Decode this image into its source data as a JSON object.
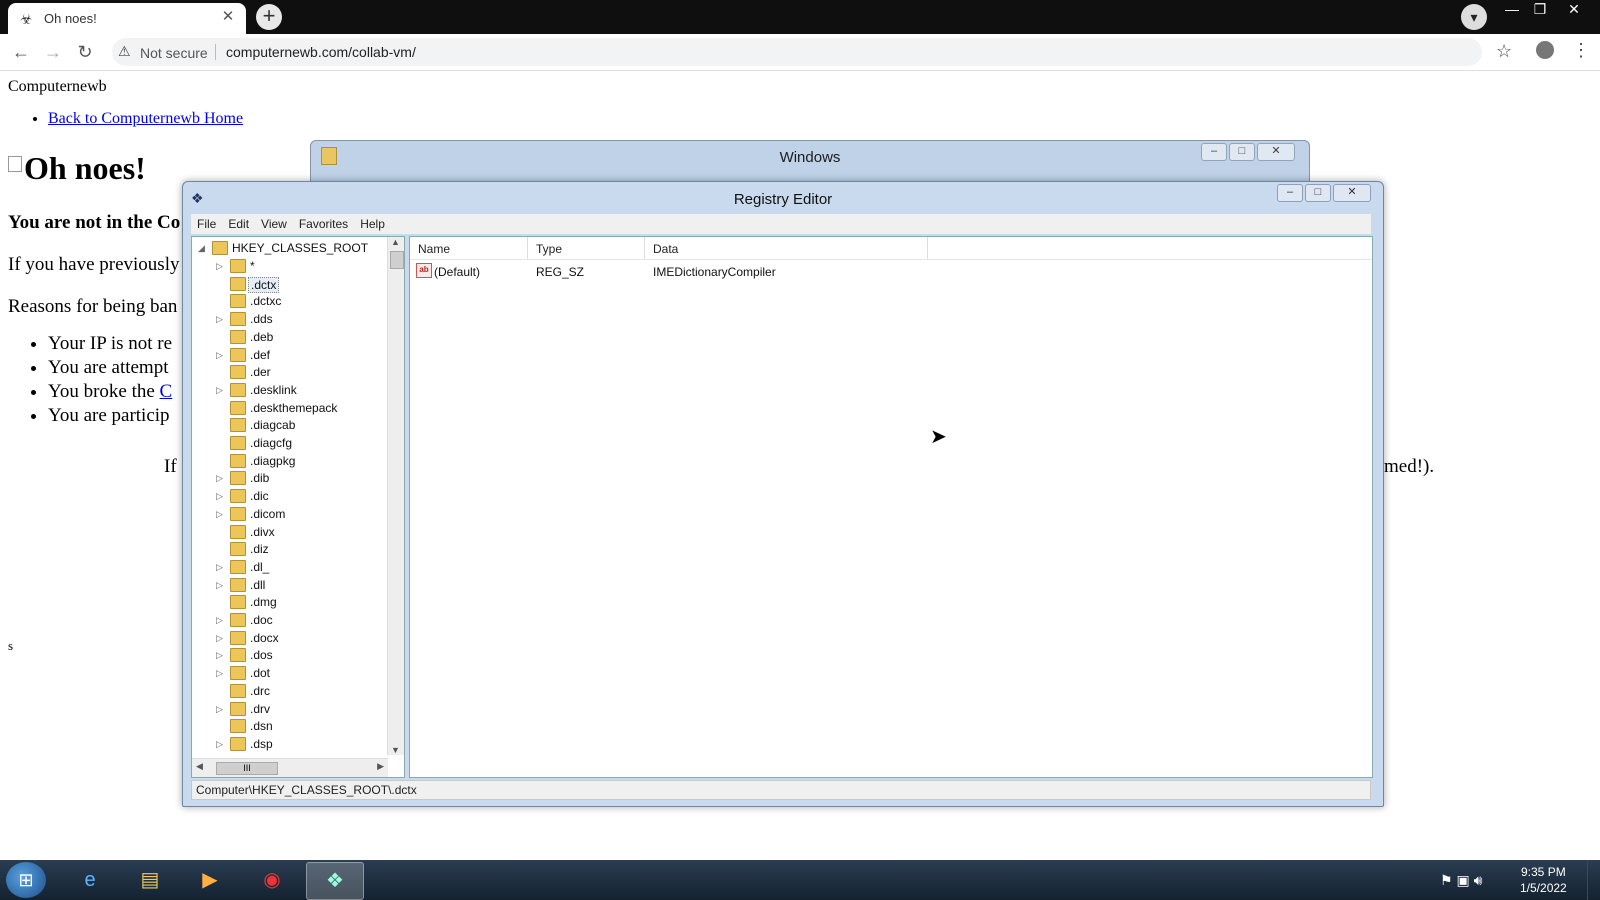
{
  "browser": {
    "tab_title": "Oh noes!",
    "new_tab": "+",
    "not_secure": "Not secure",
    "url": "computernewb.com/collab-vm/"
  },
  "page": {
    "site_name": "Computernewb",
    "back_link": "Back to Computernewb Home",
    "heading": "Oh noes!",
    "bold_line": "You are not in the Co",
    "para1": "If you have previously",
    "para2": "Reasons for being ban",
    "reasons": [
      {
        "text": "Your IP is not re",
        "link": ""
      },
      {
        "text": "You are attempt",
        "link": ""
      },
      {
        "text": "You broke the ",
        "link": "C"
      },
      {
        "text": "You are particip",
        "link": ""
      }
    ],
    "para3_head": "If",
    "para3_tail": "med!).",
    "stray_char": "s"
  },
  "back_window": {
    "title": "Windows"
  },
  "regedit": {
    "title": "Registry Editor",
    "menu": [
      "File",
      "Edit",
      "View",
      "Favorites",
      "Help"
    ],
    "root": "HKEY_CLASSES_ROOT",
    "keys": [
      {
        "label": "*",
        "expandable": true
      },
      {
        "label": ".dctx",
        "expandable": false,
        "selected": true
      },
      {
        "label": ".dctxc",
        "expandable": false
      },
      {
        "label": ".dds",
        "expandable": true
      },
      {
        "label": ".deb",
        "expandable": false
      },
      {
        "label": ".def",
        "expandable": true
      },
      {
        "label": ".der",
        "expandable": false
      },
      {
        "label": ".desklink",
        "expandable": true
      },
      {
        "label": ".deskthemepack",
        "expandable": false
      },
      {
        "label": ".diagcab",
        "expandable": false
      },
      {
        "label": ".diagcfg",
        "expandable": false
      },
      {
        "label": ".diagpkg",
        "expandable": false
      },
      {
        "label": ".dib",
        "expandable": true
      },
      {
        "label": ".dic",
        "expandable": true
      },
      {
        "label": ".dicom",
        "expandable": true
      },
      {
        "label": ".divx",
        "expandable": false
      },
      {
        "label": ".diz",
        "expandable": false
      },
      {
        "label": ".dl_",
        "expandable": true
      },
      {
        "label": ".dll",
        "expandable": true
      },
      {
        "label": ".dmg",
        "expandable": false
      },
      {
        "label": ".doc",
        "expandable": true
      },
      {
        "label": ".docx",
        "expandable": true
      },
      {
        "label": ".dos",
        "expandable": true
      },
      {
        "label": ".dot",
        "expandable": true
      },
      {
        "label": ".drc",
        "expandable": false
      },
      {
        "label": ".drv",
        "expandable": true
      },
      {
        "label": ".dsn",
        "expandable": false
      },
      {
        "label": ".dsp",
        "expandable": true
      }
    ],
    "columns": {
      "name": "Name",
      "type": "Type",
      "data": "Data"
    },
    "values": [
      {
        "name": "(Default)",
        "type": "REG_SZ",
        "data": "IMEDictionaryCompiler",
        "icon": "ab"
      }
    ],
    "hscroll_grip": "III",
    "status": "Computer\\HKEY_CLASSES_ROOT\\.dctx"
  },
  "taskbar": {
    "time": "9:35 PM",
    "date": "1/5/2022"
  }
}
